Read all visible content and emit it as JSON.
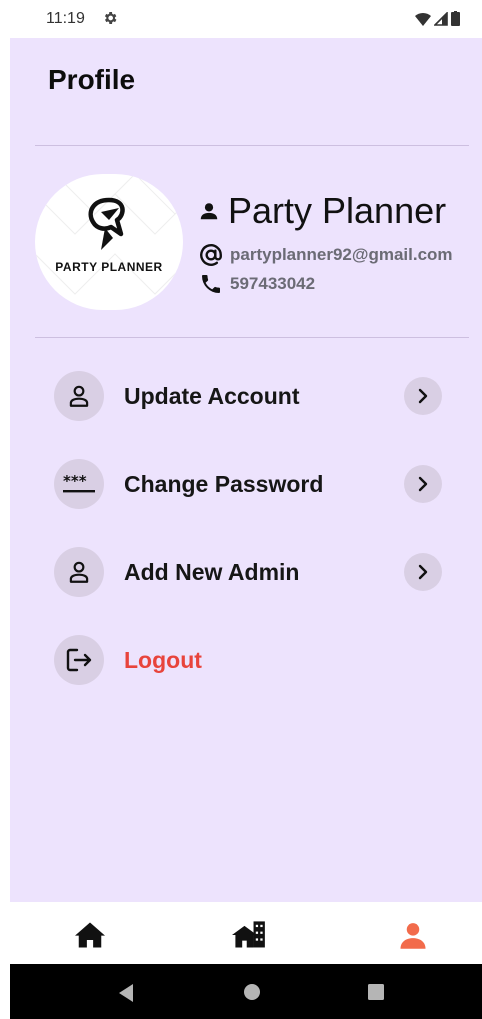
{
  "status_bar": {
    "time": "11:19"
  },
  "header": {
    "title": "Profile"
  },
  "profile": {
    "logo_text": "PARTY PLANNER",
    "name": "Party Planner",
    "email": "partyplanner92@gmail.com",
    "phone": "597433042"
  },
  "menu": {
    "update_account": "Update Account",
    "change_password": "Change Password",
    "add_new_admin": "Add New Admin",
    "logout": "Logout"
  },
  "colors": {
    "background": "#ede3fd",
    "icon_circle": "#d9cfe4",
    "logout": "#e8443c",
    "nav_active": "#f26b4b",
    "nav_inactive": "#111111"
  },
  "bottom_nav": {
    "items": [
      {
        "icon": "home-icon",
        "active": false
      },
      {
        "icon": "venues-icon",
        "active": false
      },
      {
        "icon": "person-icon",
        "active": true
      }
    ]
  }
}
